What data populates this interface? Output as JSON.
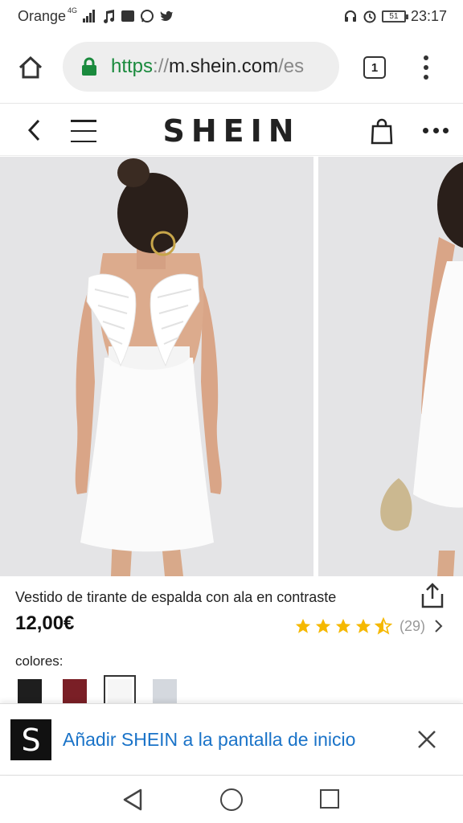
{
  "status_bar": {
    "carrier": "Orange",
    "network": "4G",
    "battery": "51",
    "time": "23:17"
  },
  "browser": {
    "url_scheme": "https",
    "url_sep": "://",
    "url_host": "m.shein.com",
    "url_path": "/es",
    "tab_count": "1"
  },
  "site": {
    "logo": "SHEIN"
  },
  "product": {
    "title": "Vestido de tirante de espalda con ala en contraste",
    "price": "12,00€",
    "rating": 4.5,
    "review_count": "(29)",
    "colors_label": "colores:",
    "swatches": [
      {
        "name": "black",
        "color": "#1e1e1e"
      },
      {
        "name": "burgundy",
        "color": "#7a1f26"
      },
      {
        "name": "white",
        "color": "#f6f6f6"
      },
      {
        "name": "light-gray",
        "color": "#d4d8de"
      }
    ]
  },
  "a2hs_banner": {
    "logo_letter": "S",
    "text": "Añadir SHEIN a la pantalla de inicio"
  },
  "colors": {
    "url_green": "#1a8a3d",
    "link_blue": "#1a73c8",
    "star_yellow": "#f5b800"
  }
}
